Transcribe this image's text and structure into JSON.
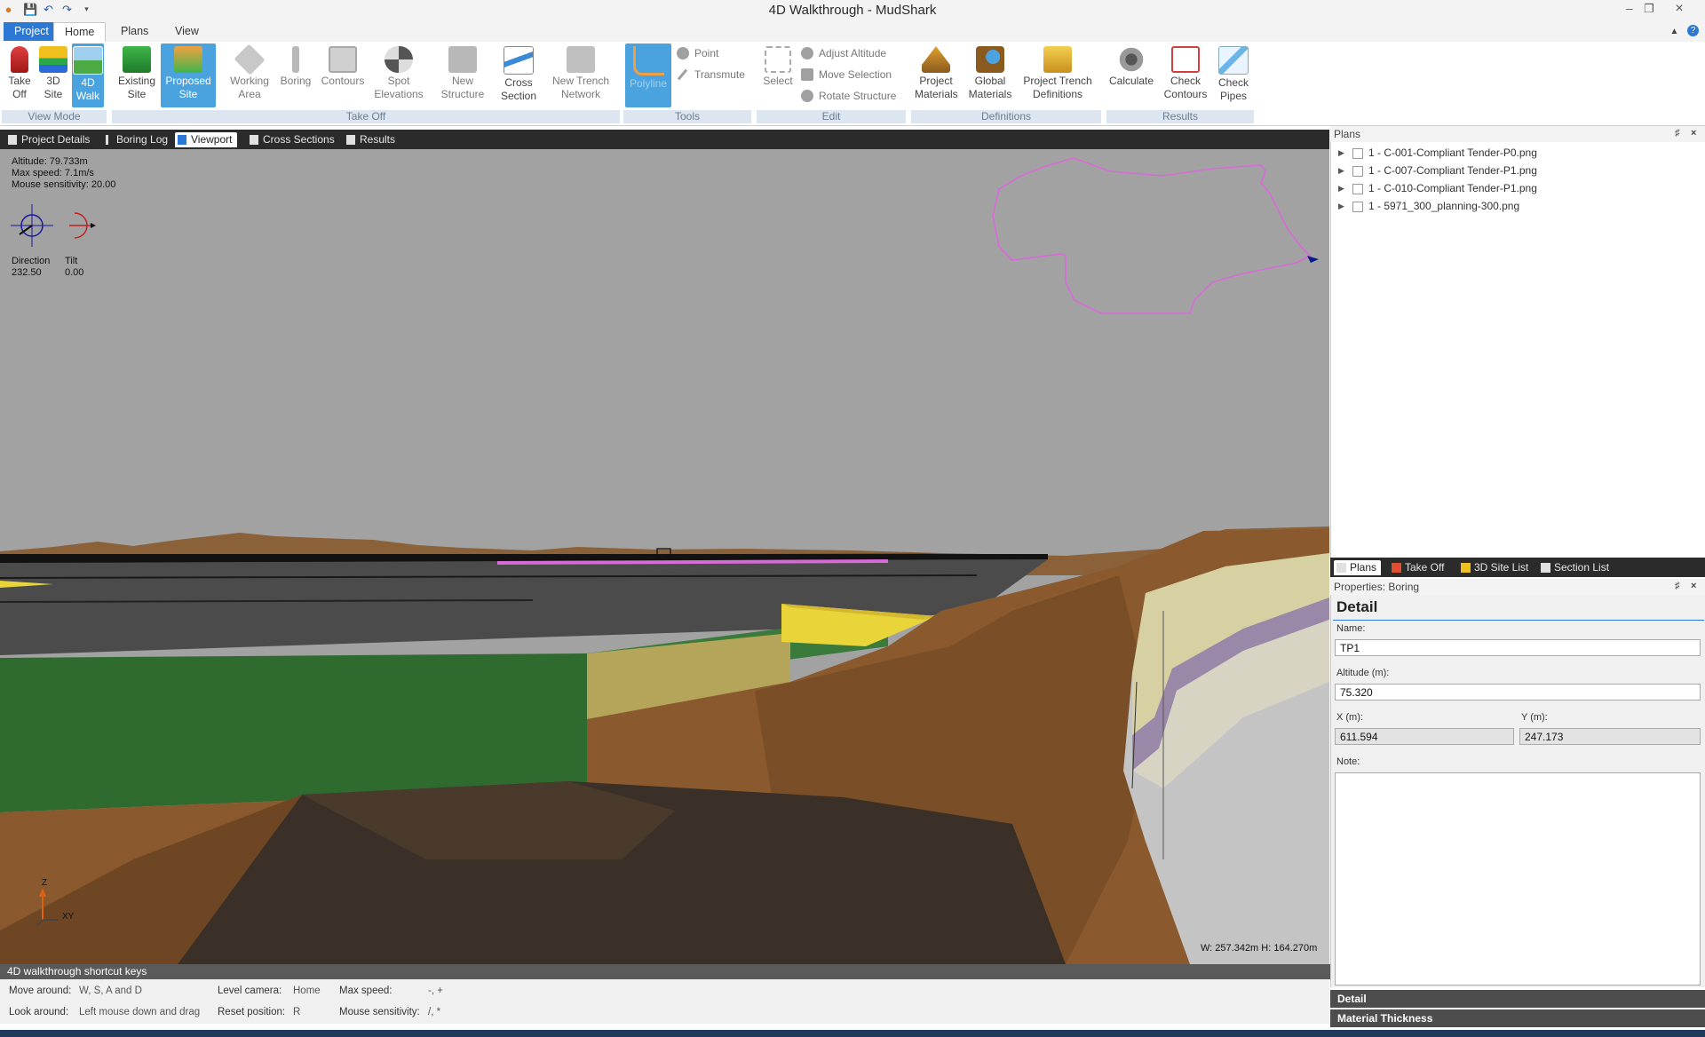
{
  "window": {
    "title": "4D Walkthrough - MudShark"
  },
  "ribbon_tabs": [
    "Project",
    "Home",
    "Plans",
    "View"
  ],
  "ribbon": {
    "view_mode": {
      "label": "View Mode",
      "buttons": [
        {
          "label": "Take\nOff",
          "icon": "take-off-icon"
        },
        {
          "label": "3D\nSite",
          "icon": "3d-site-icon"
        },
        {
          "label": "4D\nWalk",
          "icon": "4d-walk-icon"
        }
      ]
    },
    "take_off": {
      "label": "Take Off",
      "buttons": [
        {
          "label": "Existing\nSite",
          "icon": "existing-site-icon"
        },
        {
          "label": "Proposed\nSite",
          "icon": "proposed-site-icon"
        },
        {
          "label": "Working\nArea",
          "icon": "working-area-icon"
        },
        {
          "label": "Boring",
          "icon": "boring-icon"
        },
        {
          "label": "Contours",
          "icon": "contours-icon"
        },
        {
          "label": "Spot\nElevations",
          "icon": "spot-elevations-icon"
        },
        {
          "label": "New\nStructure",
          "icon": "new-structure-icon"
        },
        {
          "label": "Cross\nSection",
          "icon": "cross-section-icon"
        },
        {
          "label": "New Trench\nNetwork",
          "icon": "trench-network-icon"
        }
      ]
    },
    "tools": {
      "label": "Tools",
      "polyline": "Polyline",
      "point": "Point",
      "transmute": "Transmute"
    },
    "edit": {
      "label": "Edit",
      "select": "Select",
      "adjust_altitude": "Adjust Altitude",
      "move_selection": "Move Selection",
      "rotate_structure": "Rotate Structure"
    },
    "definitions": {
      "label": "Definitions",
      "project_materials": "Project\nMaterials",
      "global_materials": "Global\nMaterials",
      "project_trench": "Project Trench\nDefinitions"
    },
    "results": {
      "label": "Results",
      "calculate": "Calculate",
      "check_contours": "Check\nContours",
      "check_pipes": "Check\nPipes"
    }
  },
  "doc_tabs": [
    "Project Details",
    "Boring Log",
    "Viewport",
    "Cross Sections",
    "Results"
  ],
  "viewport": {
    "altitude": "Altitude: 79.733m",
    "max_speed": "Max speed: 7.1m/s",
    "mouse_sensitivity": "Mouse sensitivity: 20.00",
    "direction_label": "Direction",
    "direction_value": "232.50",
    "tilt_label": "Tilt",
    "tilt_value": "0.00",
    "axis_z": "Z",
    "axis_xy": "XY",
    "dimensions": "W: 257.342m  H: 164.270m"
  },
  "shortcuts": {
    "header": "4D walkthrough shortcut keys",
    "move_around_label": "Move around:",
    "move_around_value": "W, S, A and D",
    "look_around_label": "Look around:",
    "look_around_value": "Left mouse down and drag",
    "level_camera_label": "Level camera:",
    "level_camera_value": "Home",
    "reset_position_label": "Reset position:",
    "reset_position_value": "R",
    "max_speed_label": "Max speed:",
    "max_speed_value": "-, +",
    "mouse_sensitivity_label": "Mouse sensitivity:",
    "mouse_sensitivity_value": "/, *"
  },
  "plans_panel": {
    "title": "Plans",
    "items": [
      "1 - C-001-Compliant Tender-P0.png",
      "1 - C-007-Compliant Tender-P1.png",
      "1 - C-010-Compliant Tender-P1.png",
      "1 - 5971_300_planning-300.png"
    ]
  },
  "right_tabs": [
    "Plans",
    "Take Off",
    "3D Site List",
    "Section List"
  ],
  "properties": {
    "header": "Properties: Boring",
    "section_title": "Detail",
    "name_label": "Name:",
    "name_value": "TP1",
    "altitude_label": "Altitude (m):",
    "altitude_value": "75.320",
    "x_label": "X (m):",
    "x_value": "611.594",
    "y_label": "Y (m):",
    "y_value": "247.173",
    "note_label": "Note:",
    "accordion": [
      "Detail",
      "Material Thickness"
    ]
  },
  "colors": {
    "accent": "#2b79d4",
    "selected_button": "#4aa3df",
    "sky": "#a2a2a2",
    "terrain": "#8a5a2e",
    "grass": "#2f6a2f",
    "highlight_yellow": "#e9d53a",
    "boundary_magenta": "#d86ad8"
  }
}
